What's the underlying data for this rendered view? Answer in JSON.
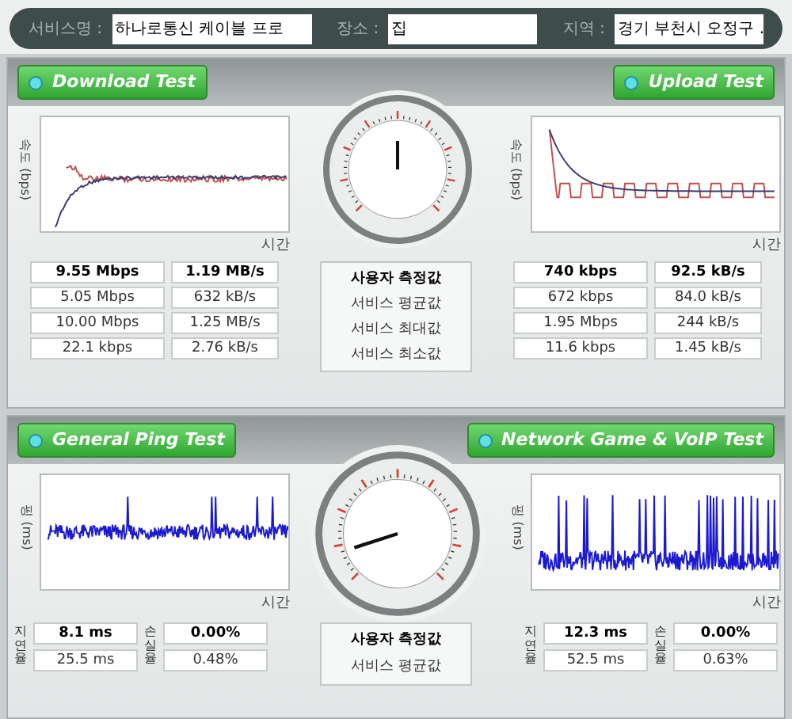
{
  "service_bar": {
    "fields": [
      {
        "label": "서비스명 :",
        "value": "하나로통신 케이블 프로"
      },
      {
        "label": "장소 :",
        "value": "집"
      },
      {
        "label": "지역 :",
        "value": "경기 부천시 오정구 ."
      }
    ]
  },
  "speed_panel": {
    "left": {
      "button": "Download Test",
      "y_label": "속도 (bps)",
      "x_label": "시간",
      "rows": [
        [
          "9.55 Mbps",
          "1.19 MB/s"
        ],
        [
          "5.05 Mbps",
          "632 kB/s"
        ],
        [
          "10.00 Mbps",
          "1.25 MB/s"
        ],
        [
          "22.1 kbps",
          "2.76 kB/s"
        ]
      ]
    },
    "legend": [
      "사용자 측정값",
      "서비스 평균값",
      "서비스 최대값",
      "서비스 최소값"
    ],
    "right": {
      "button": "Upload Test",
      "y_label": "속도 (bps)",
      "x_label": "시간",
      "rows": [
        [
          "740 kbps",
          "92.5 kB/s"
        ],
        [
          "672 kbps",
          "84.0 kB/s"
        ],
        [
          "1.95 Mbps",
          "244 kB/s"
        ],
        [
          "11.6 kbps",
          "1.45 kB/s"
        ]
      ]
    }
  },
  "ping_panel": {
    "left": {
      "button": "General Ping Test",
      "y_label": "핑 (ms)",
      "x_label": "시간",
      "latency_label": "지연율",
      "loss_label": "손실율",
      "latency": [
        "8.1 ms",
        "25.5 ms"
      ],
      "loss": [
        "0.00%",
        "0.48%"
      ]
    },
    "legend": [
      "사용자 측정값",
      "서비스 평균값"
    ],
    "right": {
      "button": "Network Game & VoIP Test",
      "y_label": "핑 (ms)",
      "x_label": "시간",
      "latency_label": "지연율",
      "loss_label": "손실율",
      "latency": [
        "12.3 ms",
        "52.5 ms"
      ],
      "loss": [
        "0.00%",
        "0.63%"
      ]
    }
  }
}
